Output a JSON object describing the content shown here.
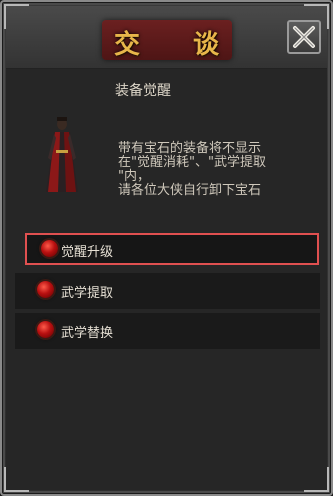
{
  "dialog": {
    "title": "交 谈",
    "close_icon": "close-x-icon"
  },
  "npc": {
    "heading": "装备觉醒",
    "portrait_icon": "npc-portrait"
  },
  "message": {
    "text": "带有宝石的装备将不显示\n在\"觉醒消耗\"、\"武学提取\n\"内，\n请各位大侠自行卸下宝石"
  },
  "options": [
    {
      "label": "觉醒升级",
      "selected": true,
      "icon": "red-orb-icon"
    },
    {
      "label": "武学提取",
      "selected": false,
      "icon": "red-orb-icon"
    },
    {
      "label": "武学替换",
      "selected": false,
      "icon": "red-orb-icon"
    }
  ],
  "colors": {
    "title": "#e8b64a",
    "highlight_border": "#e05050",
    "orb": "#c01818"
  }
}
